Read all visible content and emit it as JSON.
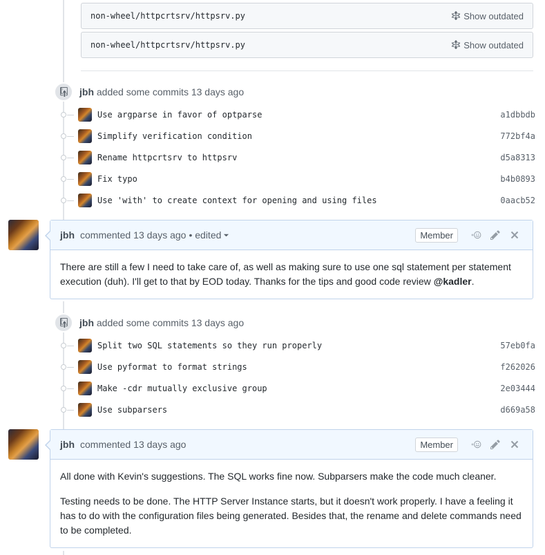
{
  "outdated_files": [
    {
      "path": "non-wheel/httpcrtsrv/httpsrv.py",
      "action": "Show outdated"
    },
    {
      "path": "non-wheel/httpcrtsrv/httpsrv.py",
      "action": "Show outdated"
    }
  ],
  "commit_groups": [
    {
      "author": "jbh",
      "text": "added some commits",
      "time": "13 days ago",
      "commits": [
        {
          "message": "Use argparse in favor of optparse",
          "sha": "a1dbbdb"
        },
        {
          "message": "Simplify verification condition",
          "sha": "772bf4a"
        },
        {
          "message": "Rename httpcrtsrv to httpsrv",
          "sha": "d5a8313"
        },
        {
          "message": "Fix typo",
          "sha": "b4b0893"
        },
        {
          "message": "Use 'with' to create context for opening and using files",
          "sha": "0aacb52"
        }
      ]
    },
    {
      "author": "jbh",
      "text": "added some commits",
      "time": "13 days ago",
      "commits": [
        {
          "message": "Split two SQL statements so they run properly",
          "sha": "57eb0fa"
        },
        {
          "message": "Use pyformat to format strings",
          "sha": "f262026"
        },
        {
          "message": "Make -cdr mutually exclusive group",
          "sha": "2e03444"
        },
        {
          "message": "Use subparsers",
          "sha": "d669a58"
        }
      ]
    }
  ],
  "comments": [
    {
      "author": "jbh",
      "action": "commented",
      "time": "13 days ago",
      "edited": "• edited",
      "role": "Member",
      "body_text": "There are still a few I need to take care of, as well as making sure to use one sql statement per statement execution (duh). I'll get to that by EOD today. Thanks for the tips and good code review ",
      "mention": "@kadler",
      "body_end": "."
    },
    {
      "author": "jbh",
      "action": "commented",
      "time": "13 days ago",
      "role": "Member",
      "para1": "All done with Kevin's suggestions. The SQL works fine now. Subparsers make the code much cleaner.",
      "para2": "Testing needs to be done. The HTTP Server Instance starts, but it doesn't work properly. I have a feeling it has to do with the configuration files being generated. Besides that, the rename and delete commands need to be completed."
    }
  ],
  "icons": {
    "show_outdated": "unfold-icon",
    "commits_badge": "repo-push-icon",
    "reaction": "smiley-icon",
    "edit": "pencil-icon",
    "delete": "x-icon"
  }
}
